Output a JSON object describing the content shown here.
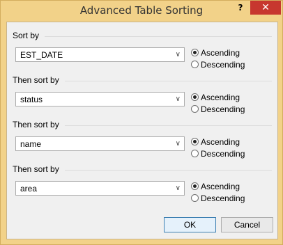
{
  "window": {
    "title": "Advanced Table Sorting",
    "help_label": "?",
    "close_label": "✕"
  },
  "sort_levels": [
    {
      "label": "Sort by",
      "value": "EST_DATE",
      "ascending": "Ascending",
      "descending": "Descending",
      "selected": "ascending"
    },
    {
      "label": "Then sort by",
      "value": "status",
      "ascending": "Ascending",
      "descending": "Descending",
      "selected": "ascending"
    },
    {
      "label": "Then sort by",
      "value": "name",
      "ascending": "Ascending",
      "descending": "Descending",
      "selected": "ascending"
    },
    {
      "label": "Then sort by",
      "value": "area",
      "ascending": "Ascending",
      "descending": "Descending",
      "selected": "ascending"
    }
  ],
  "buttons": {
    "ok_label": "OK",
    "cancel_label": "Cancel"
  },
  "icons": {
    "dropdown": "chevron-down-icon"
  }
}
